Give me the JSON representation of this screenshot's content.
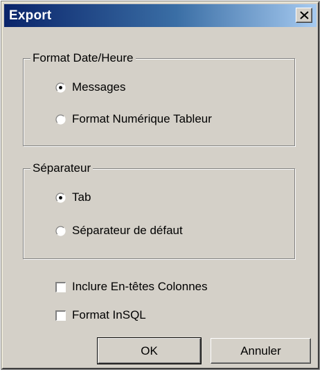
{
  "dialog": {
    "title": "Export",
    "close_glyph": "×"
  },
  "format_group": {
    "label": "Format Date/Heure",
    "options": [
      {
        "label": "Messages",
        "selected": true
      },
      {
        "label": "Format Numérique Tableur",
        "selected": false
      }
    ]
  },
  "separator_group": {
    "label": "Séparateur",
    "options": [
      {
        "label": "Tab",
        "selected": true
      },
      {
        "label": "Séparateur de défaut",
        "selected": false
      }
    ]
  },
  "checkboxes": [
    {
      "label": "Inclure En-têtes Colonnes",
      "checked": false
    },
    {
      "label": "Format InSQL",
      "checked": false
    }
  ],
  "buttons": {
    "ok": "OK",
    "cancel": "Annuler"
  },
  "icons": {
    "close": "close-icon",
    "radio_selected": "radio-selected-icon",
    "radio_unselected": "radio-unselected-icon",
    "checkbox": "checkbox-icon"
  },
  "colors": {
    "title_gradient_start": "#0a246a",
    "title_gradient_end": "#a6caf0",
    "face": "#d4d0c8"
  }
}
